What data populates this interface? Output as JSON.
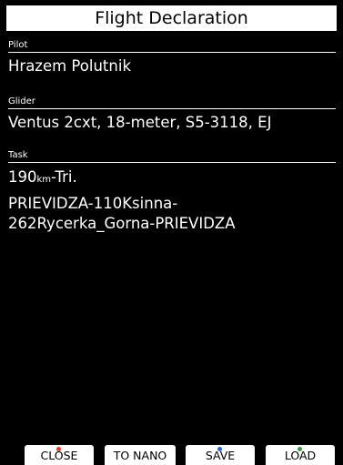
{
  "header": {
    "title": "Flight Declaration"
  },
  "pilot": {
    "label": "Pilot",
    "value": "Hrazem Polutnik"
  },
  "glider": {
    "label": "Glider",
    "value": "Ventus 2cxt, 18-meter, S5-3118, EJ"
  },
  "task": {
    "label": "Task",
    "distance": "190",
    "distance_unit": "km",
    "type": "-Tri.",
    "route_line1": "PRIEVIDZA-110Ksinna-",
    "route_line2": "262Rycerka_Gorna-PRIEVIDZA"
  },
  "buttons": [
    {
      "label": "CLOSE",
      "indicator_color": "#e53935",
      "indicator": "red-dot-icon"
    },
    {
      "label": "TO NANO",
      "indicator_color": null,
      "indicator": null
    },
    {
      "label": "SAVE",
      "indicator_color": "#1e66d9",
      "indicator": "blue-dot-icon"
    },
    {
      "label": "LOAD",
      "indicator_color": "#2e9d3a",
      "indicator": "green-dot-icon"
    }
  ],
  "colors": {
    "background": "#000000",
    "foreground": "#ffffff"
  }
}
